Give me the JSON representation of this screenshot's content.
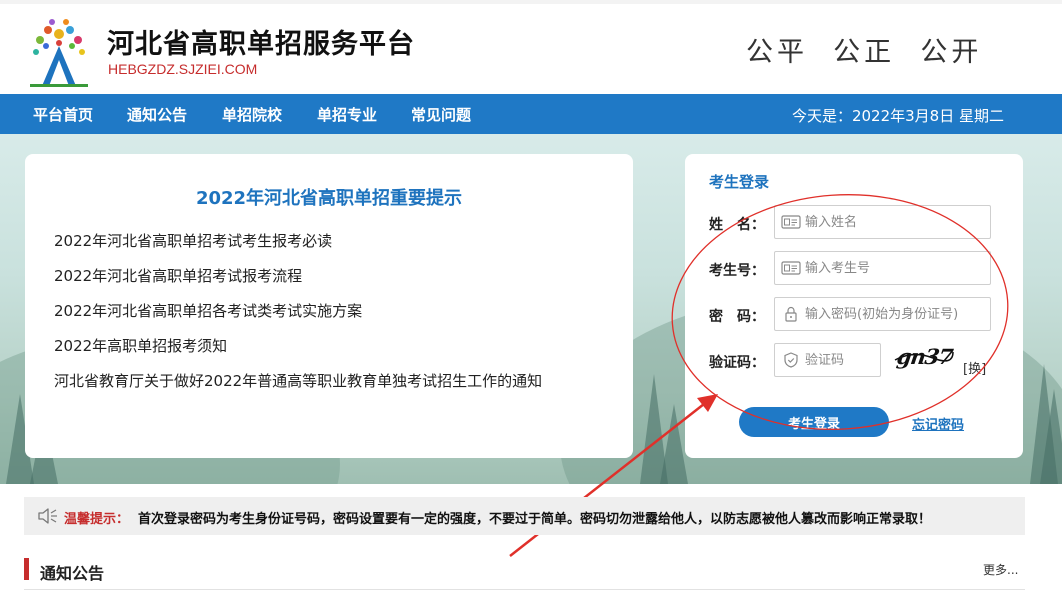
{
  "header": {
    "site_title": "河北省高职单招服务平台",
    "site_url": "HEBGZDZ.SJZIEI.COM",
    "slogan": "公平  公正  公开",
    "logo_icon": "tree-people-logo-icon"
  },
  "nav": {
    "items": [
      {
        "label": "平台首页"
      },
      {
        "label": "通知公告"
      },
      {
        "label": "单招院校"
      },
      {
        "label": "单招专业"
      },
      {
        "label": "常见问题"
      }
    ],
    "date_text": "今天是：2022年3月8日 星期二"
  },
  "notice": {
    "title": "2022年河北省高职单招重要提示",
    "items": [
      "2022年河北省高职单招考试考生报考必读",
      "2022年河北省高职单招考试报考流程",
      "2022年河北省高职单招各考试类考试实施方案",
      "2022年高职单招报考须知",
      "河北省教育厅关于做好2022年普通高等职业教育单独考试招生工作的通知"
    ]
  },
  "login": {
    "title": "考生登录",
    "name_label": "姓　名：",
    "name_placeholder": "输入姓名",
    "exam_label": "考生号：",
    "exam_placeholder": "输入考生号",
    "password_label": "密　码：",
    "password_placeholder": "输入密码(初始为身份证号)",
    "captcha_label": "验证码：",
    "captcha_placeholder": "验证码",
    "captcha_text": "gn37",
    "refresh_label": "[换]",
    "login_button": "考生登录",
    "forgot_link": "忘记密码"
  },
  "tip": {
    "label": "温馨提示：",
    "text": "首次登录密码为考生身份证号码，密码设置要有一定的强度，不要过于简单。密码切勿泄露给他人，以防志愿被他人篡改而影响正常录取！"
  },
  "section": {
    "title": "通知公告",
    "more": "更多..."
  },
  "colors": {
    "brand_blue": "#1f79c6",
    "accent_red": "#c62d2d",
    "annotation_red": "#e0302a"
  }
}
